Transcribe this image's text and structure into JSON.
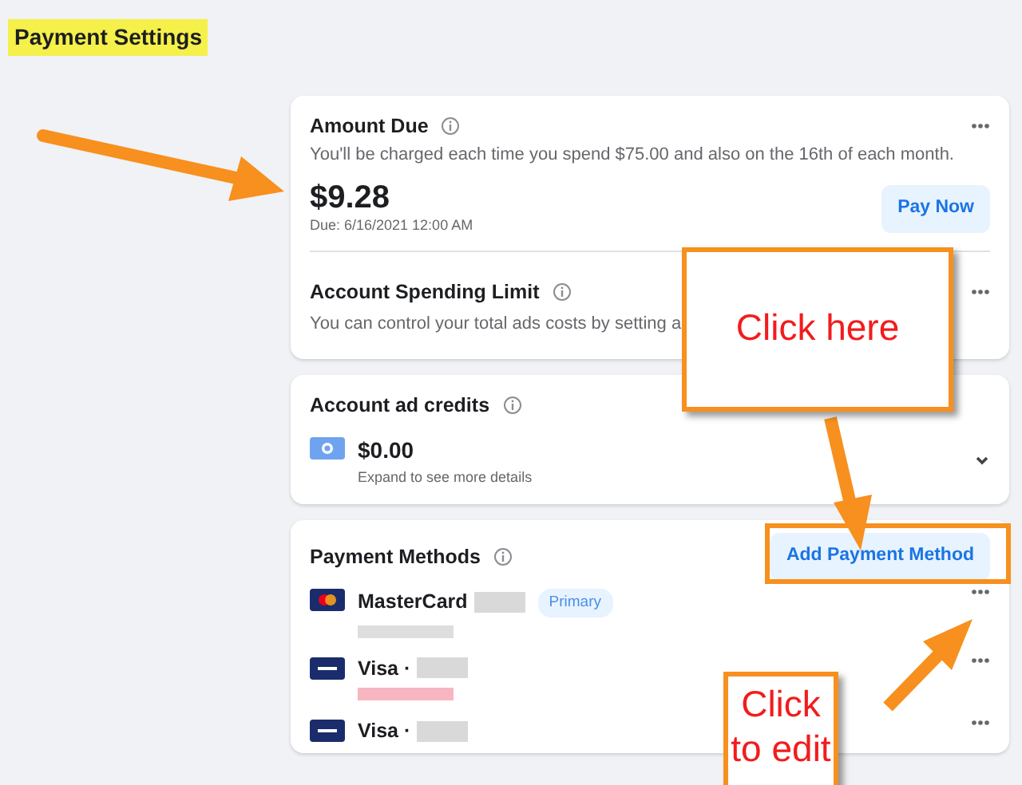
{
  "page_title": "Payment Settings",
  "amount_due": {
    "title": "Amount Due",
    "description": "You'll be charged each time you spend $75.00 and also on the 16th of each month.",
    "amount": "$9.28",
    "due": "Due: 6/16/2021 12:00 AM",
    "button": "Pay Now"
  },
  "spending_limit": {
    "title": "Account Spending Limit",
    "description": "You can control your total ads costs by setting a"
  },
  "ad_credits": {
    "title": "Account ad credits",
    "amount": "$0.00",
    "hint": "Expand to see more details"
  },
  "payment_methods": {
    "title": "Payment Methods",
    "button": "Add Payment Method",
    "methods": [
      {
        "kind": "mastercard",
        "name": "MasterCard",
        "badge": "Primary",
        "expired": false
      },
      {
        "kind": "visa",
        "name": "Visa ·",
        "expired": true
      },
      {
        "kind": "visa",
        "name": "Visa ·"
      }
    ]
  },
  "annotations": [
    {
      "text": "Click here"
    },
    {
      "text": "Click to edit"
    }
  ]
}
